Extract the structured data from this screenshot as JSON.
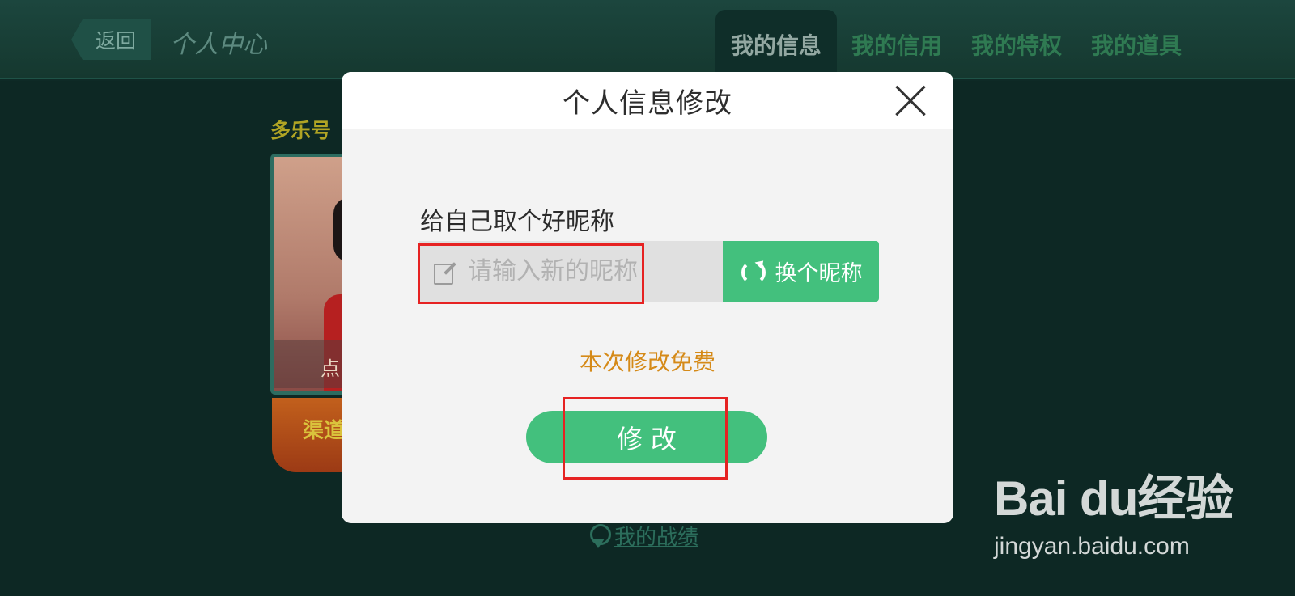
{
  "header": {
    "back_label": "返回",
    "title": "个人中心",
    "tabs": [
      {
        "label": "我的信息",
        "active": true
      },
      {
        "label": "我的信用",
        "active": false
      },
      {
        "label": "我的特权",
        "active": false
      },
      {
        "label": "我的道具",
        "active": false
      }
    ]
  },
  "profile": {
    "id_label": "多乐号",
    "avatar_caption": "点",
    "channel_label": "渠道",
    "record_link": "我的战绩"
  },
  "dialog": {
    "title": "个人信息修改",
    "prompt": "给自己取个好昵称",
    "nickname_placeholder": "请输入新的昵称",
    "nickname_value": "",
    "change_name_label": "换个昵称",
    "free_note": "本次修改免费",
    "submit_label": "修改"
  },
  "watermark": {
    "brand": "Bai du经验",
    "url": "jingyan.baidu.com"
  },
  "colors": {
    "accent_green": "#43c07d",
    "note_orange": "#d58a18",
    "annotation_red": "#e62222",
    "background_dark": "#0e2a26"
  },
  "icons": {
    "close": "close-icon",
    "edit": "edit-icon",
    "refresh": "refresh-icon",
    "medal": "medal-icon"
  }
}
